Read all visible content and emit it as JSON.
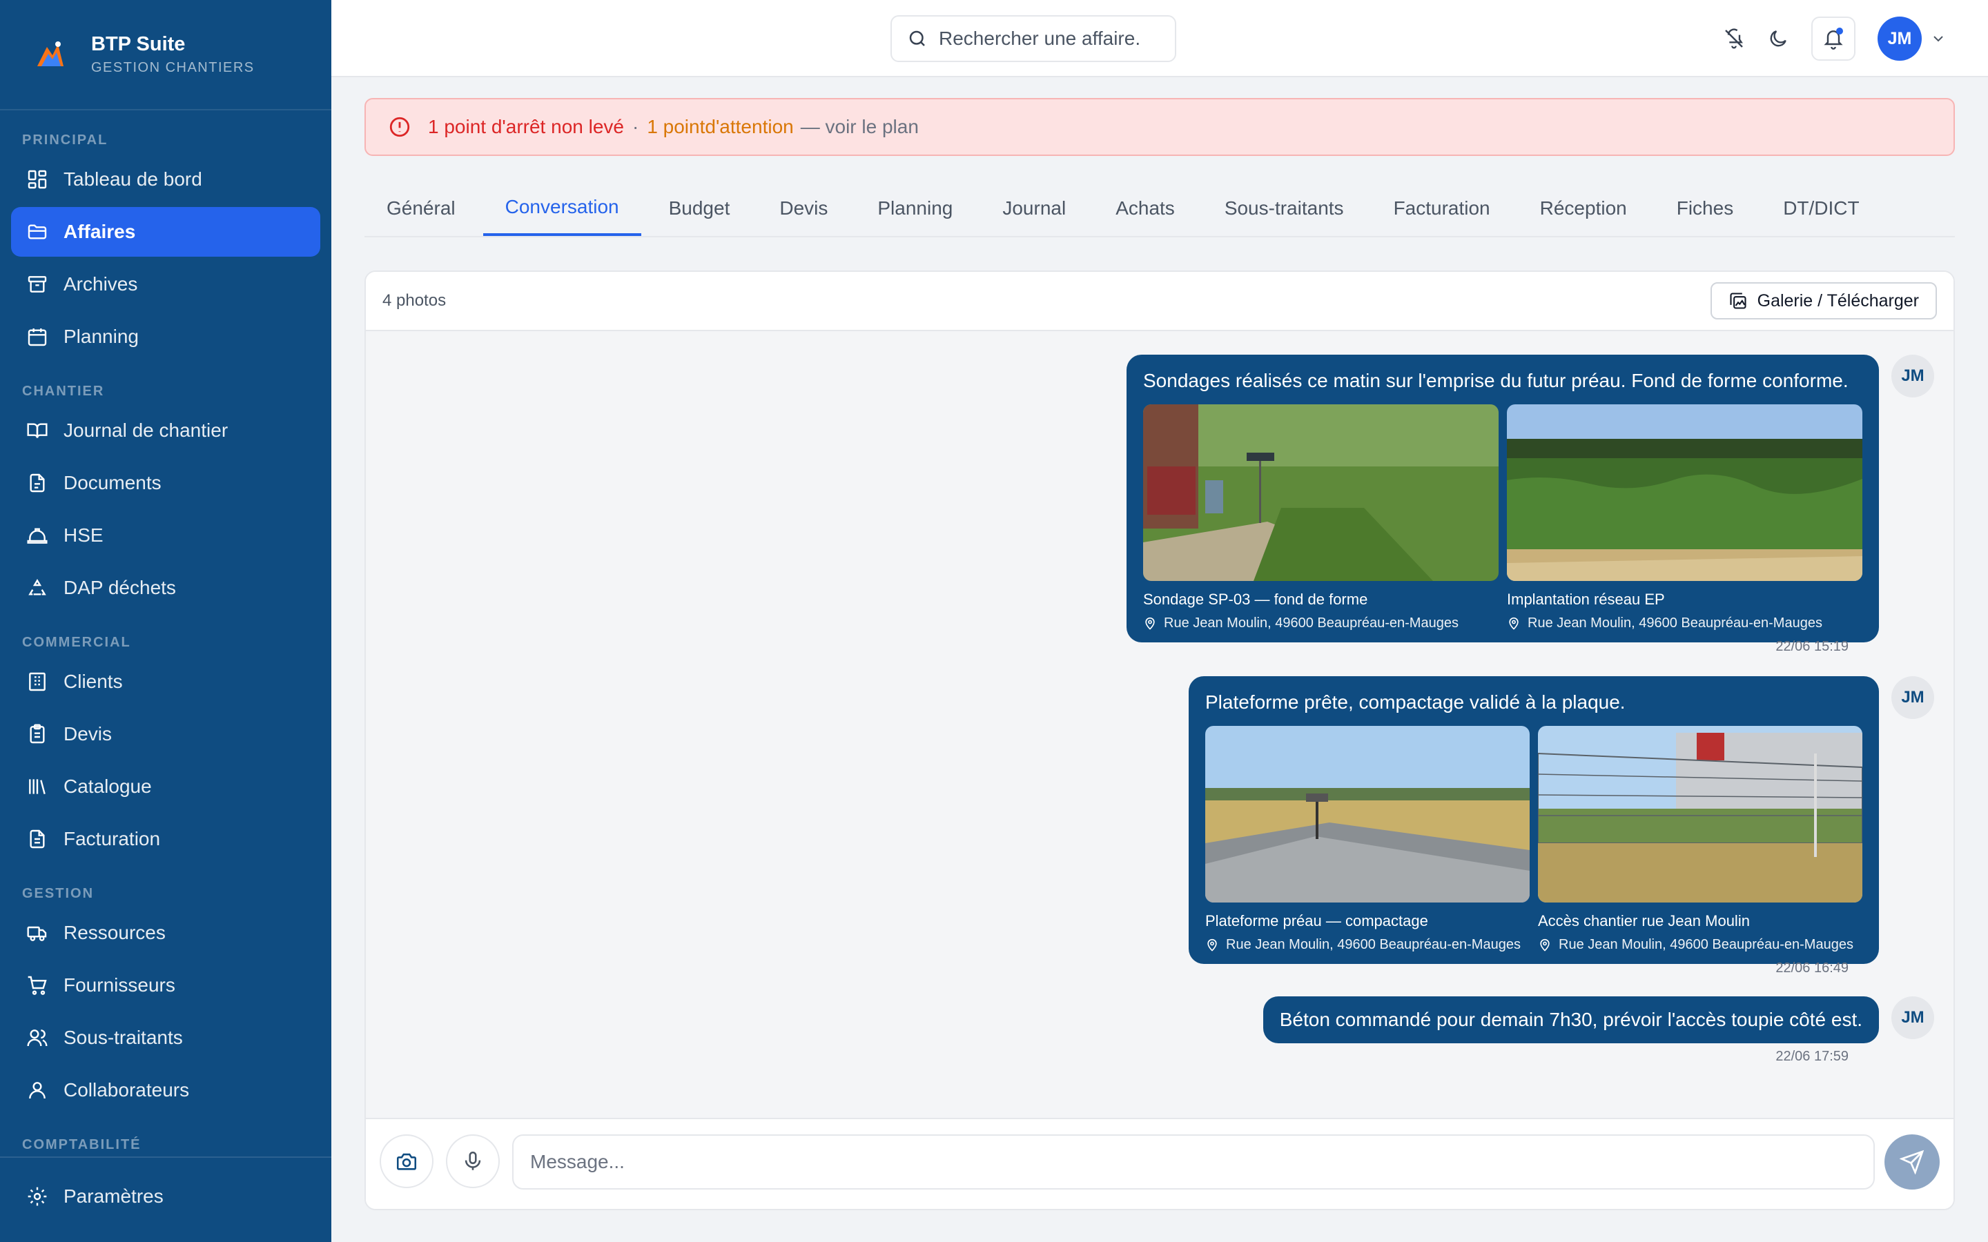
{
  "brand": {
    "title": "BTP Suite",
    "subtitle": "GESTION CHANTIERS"
  },
  "sidebar": {
    "sections": [
      {
        "label": "PRINCIPAL",
        "items": [
          {
            "label": "Tableau de bord",
            "icon": "dashboard-icon"
          },
          {
            "label": "Affaires",
            "icon": "folder-icon",
            "active": true
          },
          {
            "label": "Archives",
            "icon": "archive-icon"
          },
          {
            "label": "Planning",
            "icon": "calendar-icon"
          }
        ]
      },
      {
        "label": "CHANTIER",
        "items": [
          {
            "label": "Journal de chantier",
            "icon": "book-icon"
          },
          {
            "label": "Documents",
            "icon": "document-icon"
          },
          {
            "label": "HSE",
            "icon": "hard-hat-icon"
          },
          {
            "label": "DAP déchets",
            "icon": "recycle-icon"
          }
        ]
      },
      {
        "label": "COMMERCIAL",
        "items": [
          {
            "label": "Clients",
            "icon": "building-icon"
          },
          {
            "label": "Devis",
            "icon": "clipboard-icon"
          },
          {
            "label": "Catalogue",
            "icon": "library-icon"
          },
          {
            "label": "Facturation",
            "icon": "receipt-icon"
          }
        ]
      },
      {
        "label": "GESTION",
        "items": [
          {
            "label": "Ressources",
            "icon": "truck-icon"
          },
          {
            "label": "Fournisseurs",
            "icon": "cart-icon"
          },
          {
            "label": "Sous-traitants",
            "icon": "users-icon"
          },
          {
            "label": "Collaborateurs",
            "icon": "user-icon"
          }
        ]
      }
    ],
    "cut_section": "COMPTABILITÉ",
    "settings_label": "Paramètres"
  },
  "search": {
    "placeholder": "Rechercher une affaire."
  },
  "user": {
    "initials": "JM"
  },
  "alert": {
    "stop_points": "1 point d'arrêt non levé",
    "separator": "·",
    "attention": "1 pointd'attention",
    "link": "— voir le plan"
  },
  "tabs": [
    "Général",
    "Conversation",
    "Budget",
    "Devis",
    "Planning",
    "Journal",
    "Achats",
    "Sous-traitants",
    "Facturation",
    "Réception",
    "Fiches",
    "DT/DICT"
  ],
  "active_tab": "Conversation",
  "conversation": {
    "photo_count": "4 photos",
    "gallery_label": "Galerie / Télécharger",
    "messages": [
      {
        "text": "Sondages réalisés ce matin sur l'emprise du futur préau. Fond de forme conforme.",
        "time": "22/06 15:19",
        "author": "JM",
        "photos": [
          {
            "caption": "Sondage SP-03 — fond de forme",
            "location": "Rue Jean Moulin, 49600 Beaupréau-en-Mauges"
          },
          {
            "caption": "Implantation réseau EP",
            "location": "Rue Jean Moulin, 49600 Beaupréau-en-Mauges"
          }
        ]
      },
      {
        "text": "Plateforme prête, compactage validé à la plaque.",
        "time": "22/06 16:49",
        "author": "JM",
        "photos": [
          {
            "caption": "Plateforme préau — compactage",
            "location": "Rue Jean Moulin, 49600 Beaupréau-en-Mauges"
          },
          {
            "caption": "Accès chantier rue Jean Moulin",
            "location": "Rue Jean Moulin, 49600 Beaupréau-en-Mauges"
          }
        ]
      },
      {
        "text": "Béton commandé pour demain 7h30, prévoir l'accès toupie côté est.",
        "time": "22/06 17:59",
        "author": "JM",
        "photos": []
      }
    ],
    "composer_placeholder": "Message..."
  },
  "colors": {
    "sidebar": "#0f4c81",
    "accent": "#2563eb",
    "alert_bg": "#fde2e2",
    "alert_red": "#dc2626",
    "alert_amber": "#d97706",
    "bubble": "#0f4c81"
  }
}
